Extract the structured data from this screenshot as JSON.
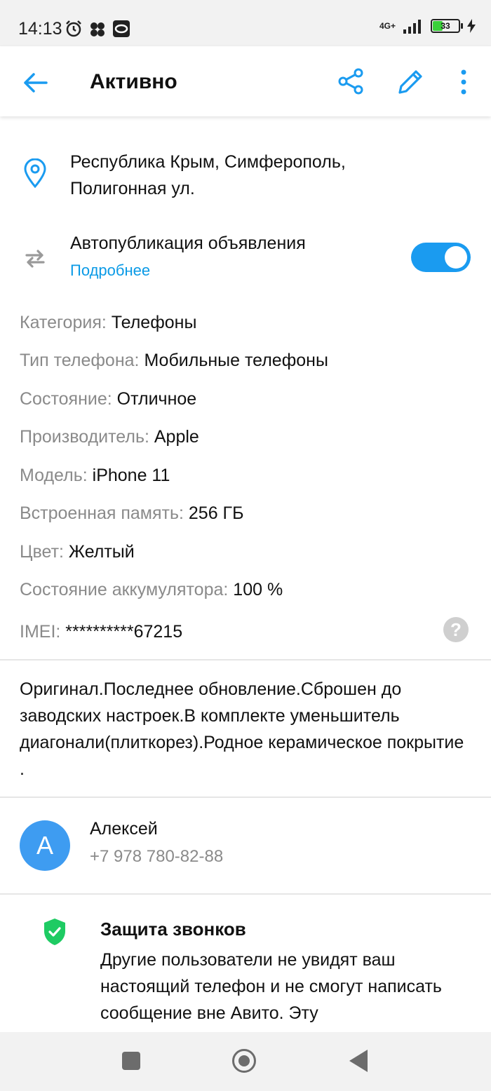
{
  "status_bar": {
    "time": "14:13",
    "network": "4G+",
    "battery": "33"
  },
  "header": {
    "title": "Активно",
    "accent_color": "#1a9bf0"
  },
  "location": {
    "line1": "Республика Крым, Симферополь,",
    "line2": "Полигонная ул."
  },
  "autopublish": {
    "title": "Автопубликация объявления",
    "link": "Подробнее",
    "enabled": true
  },
  "params": [
    {
      "key": "Категория:",
      "value": "Телефоны"
    },
    {
      "key": "Тип телефона:",
      "value": "Мобильные телефоны"
    },
    {
      "key": "Состояние:",
      "value": "Отличное"
    },
    {
      "key": "Производитель:",
      "value": "Apple"
    },
    {
      "key": "Модель:",
      "value": "iPhone 11"
    },
    {
      "key": "Встроенная память:",
      "value": "256 ГБ"
    },
    {
      "key": "Цвет:",
      "value": "Желтый"
    },
    {
      "key": "Состояние аккумулятора:",
      "value": "100 %"
    },
    {
      "key": "IMEI:",
      "value": "**********67215"
    }
  ],
  "description": "Оригинал.Последнее обновление.Сброшен до заводских настроек.В комплекте уменьшитель диагонали(плиткорез).Родное керамическое покрытие .",
  "seller": {
    "initial": "А",
    "name": "Алексей",
    "phone": "+7 978 780-82-88"
  },
  "call_protection": {
    "title": "Защита звонков",
    "text": "Другие пользователи не увидят ваш настоящий телефон и не смогут написать сообщение вне Авито. Эту"
  }
}
